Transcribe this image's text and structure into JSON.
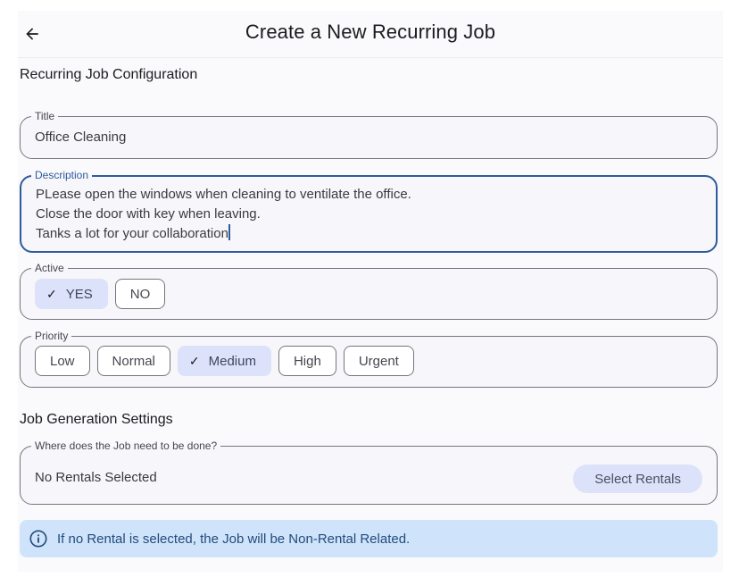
{
  "appbar": {
    "title": "Create a New Recurring Job",
    "back_icon": "arrow-left-icon"
  },
  "config_section": {
    "title": "Recurring Job Configuration",
    "title_field": {
      "label": "Title",
      "value": "Office Cleaning"
    },
    "description_field": {
      "label": "Description",
      "lines": [
        "PLease open the windows when cleaning to ventilate the office.",
        "Close the door with key when leaving.",
        "Tanks a lot for your collaboration"
      ],
      "focused": true
    },
    "active": {
      "label": "Active",
      "options": [
        {
          "label": "YES",
          "selected": true
        },
        {
          "label": "NO",
          "selected": false
        }
      ]
    },
    "priority": {
      "label": "Priority",
      "options": [
        {
          "label": "Low",
          "selected": false
        },
        {
          "label": "Normal",
          "selected": false
        },
        {
          "label": "Medium",
          "selected": true
        },
        {
          "label": "High",
          "selected": false
        },
        {
          "label": "Urgent",
          "selected": false
        }
      ]
    }
  },
  "generation_section": {
    "title": "Job Generation Settings",
    "location_field": {
      "label": "Where does the Job need to be done?",
      "value": "No Rentals Selected",
      "button_label": "Select Rentals"
    },
    "info_banner": {
      "icon": "info-icon",
      "text": "If no Rental is selected, the Job will be Non-Rental Related."
    }
  },
  "colors": {
    "accent": "#2f5b9c",
    "chip_selected_bg": "#dce2f9",
    "info_bg": "#cfe4fb",
    "info_text": "#234a7a"
  }
}
